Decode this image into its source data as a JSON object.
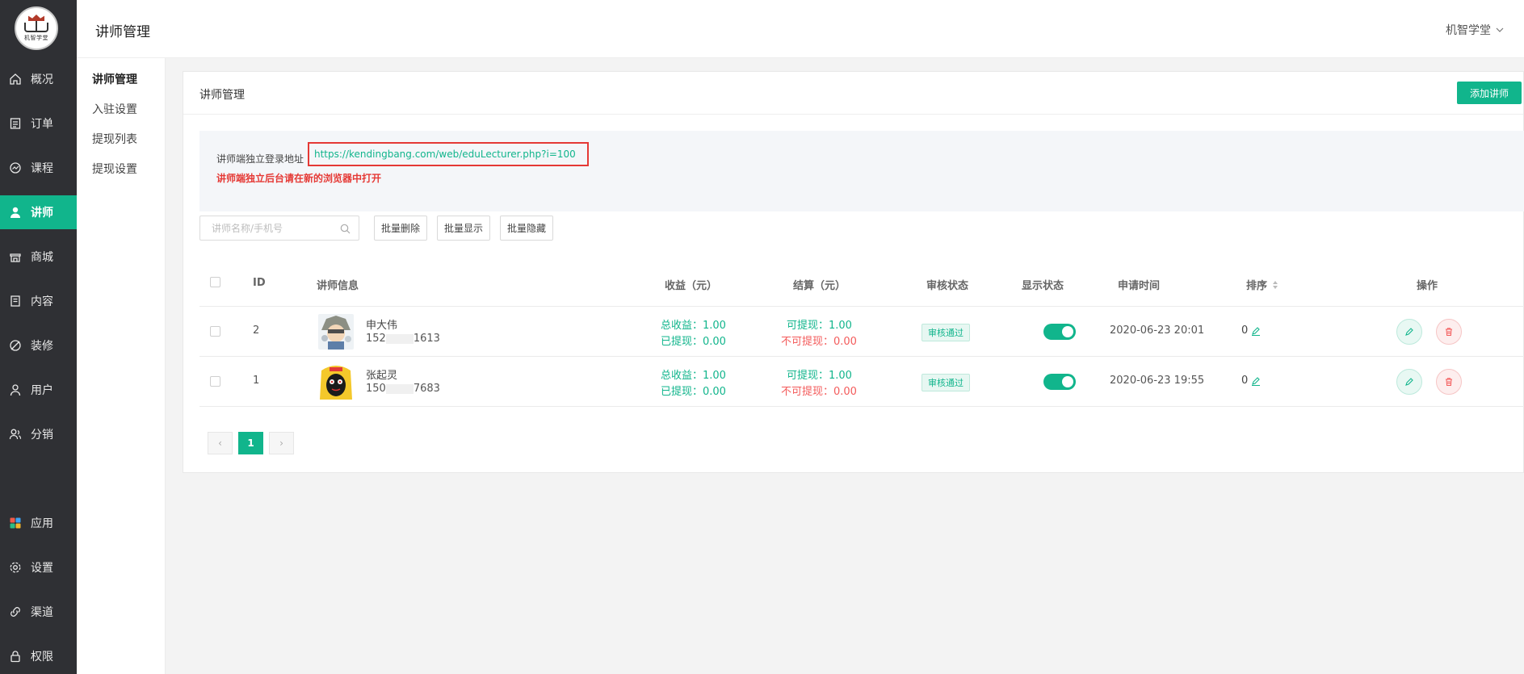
{
  "brand": {
    "logo_text": "机智学堂"
  },
  "nav": {
    "items": [
      {
        "label": "概况",
        "icon": "home-icon"
      },
      {
        "label": "订单",
        "icon": "order-icon"
      },
      {
        "label": "课程",
        "icon": "course-icon"
      },
      {
        "label": "讲师",
        "icon": "lecturer-icon",
        "active": true
      },
      {
        "label": "商城",
        "icon": "store-icon"
      },
      {
        "label": "内容",
        "icon": "content-icon"
      },
      {
        "label": "装修",
        "icon": "decorate-icon"
      },
      {
        "label": "用户",
        "icon": "user-icon"
      },
      {
        "label": "分销",
        "icon": "distribution-icon"
      },
      {
        "label": "应用",
        "icon": "apps-icon"
      },
      {
        "label": "设置",
        "icon": "gear-icon"
      },
      {
        "label": "渠道",
        "icon": "channel-icon"
      },
      {
        "label": "权限",
        "icon": "lock-icon"
      }
    ]
  },
  "subnav": {
    "items": [
      {
        "label": "讲师管理",
        "active": true
      },
      {
        "label": "入驻设置"
      },
      {
        "label": "提现列表"
      },
      {
        "label": "提现设置"
      }
    ]
  },
  "header": {
    "title": "讲师管理",
    "account": "机智学堂"
  },
  "card": {
    "title": "讲师管理",
    "add_button": "添加讲师"
  },
  "info": {
    "label": "讲师端独立登录地址",
    "url": "https://kendingbang.com/web/eduLecturer.php?i=100",
    "warning": "讲师端独立后台请在新的浏览器中打开"
  },
  "toolbar": {
    "search_placeholder": "讲师名称/手机号",
    "batch_delete": "批量删除",
    "batch_show": "批量显示",
    "batch_hide": "批量隐藏"
  },
  "table": {
    "headers": {
      "id": "ID",
      "info": "讲师信息",
      "income": "收益（元）",
      "settle": "结算（元）",
      "audit": "审核状态",
      "display": "显示状态",
      "apply_time": "申请时间",
      "sort": "排序",
      "ops": "操作"
    },
    "rows": [
      {
        "id": "2",
        "name": "申大伟",
        "phone_prefix": "152",
        "phone_suffix": "1613",
        "total_income": "总收益：1.00",
        "withdrawn": "已提现：0.00",
        "withdrawable": "可提现：1.00",
        "not_withdrawable": "不可提现：0.00",
        "audit": "审核通过",
        "display_on": true,
        "apply_time": "2020-06-23 20:01",
        "sort": "0"
      },
      {
        "id": "1",
        "name": "张起灵",
        "phone_prefix": "150",
        "phone_suffix": "7683",
        "total_income": "总收益：1.00",
        "withdrawn": "已提现：0.00",
        "withdrawable": "可提现：1.00",
        "not_withdrawable": "不可提现：0.00",
        "audit": "审核通过",
        "display_on": true,
        "apply_time": "2020-06-23 19:55",
        "sort": "0"
      }
    ]
  },
  "pagination": {
    "current": "1",
    "prev": "‹",
    "next": "›"
  },
  "colors": {
    "accent": "#11b58c",
    "danger": "#e53935",
    "nav_bg": "#2f3034"
  }
}
